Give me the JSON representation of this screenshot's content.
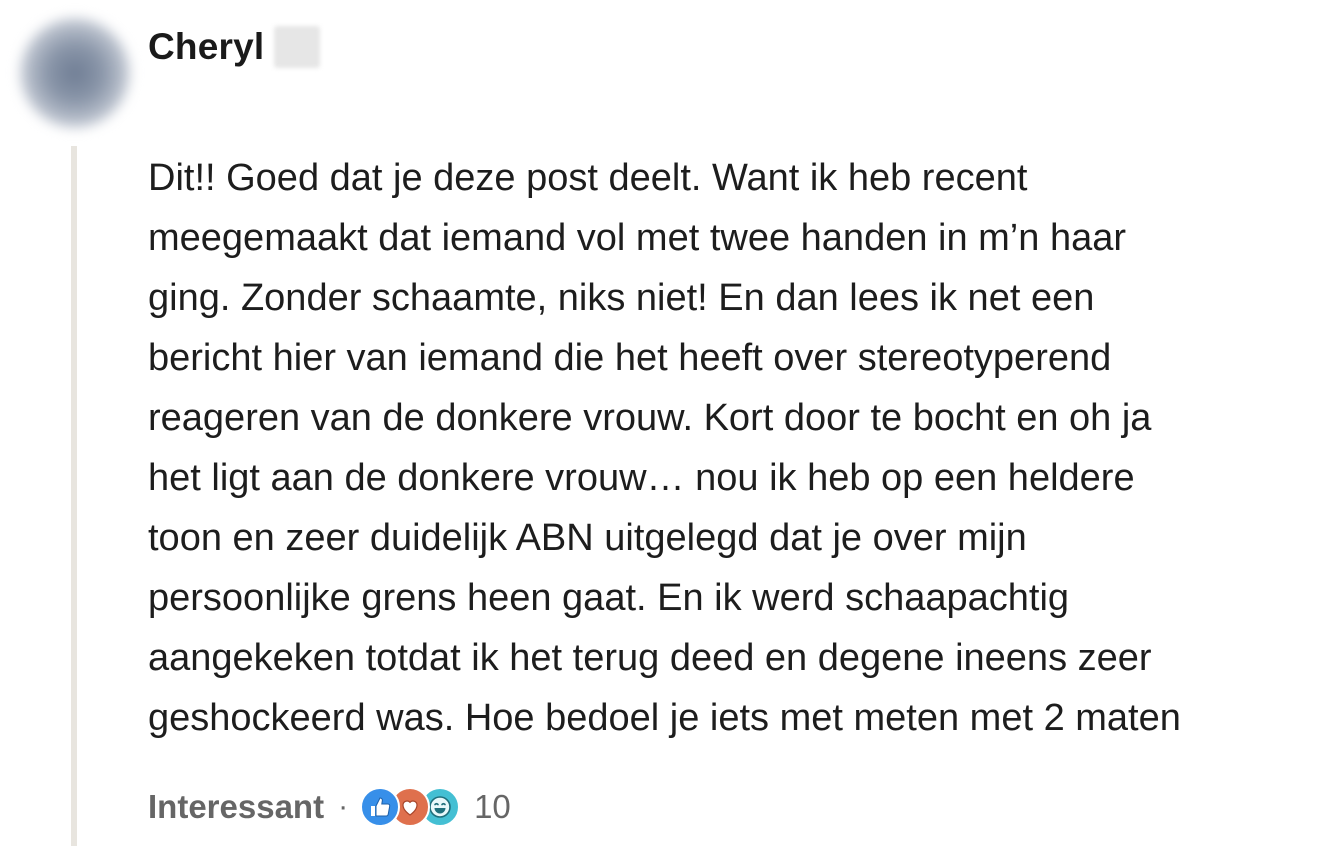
{
  "comment": {
    "author": {
      "name": "Cheryl"
    },
    "text_lines": [
      "Dit!! Goed dat je deze post deelt. Want ik heb recent",
      "meegemaakt dat iemand vol met twee handen in m’n haar",
      "ging. Zonder schaamte, niks niet! En dan lees ik net een",
      "bericht hier van iemand die het heeft over stereotyperend",
      "reageren van de donkere vrouw. Kort door te bocht en oh ja",
      "het ligt aan de donkere vrouw… nou ik heb op een heldere",
      "toon en zeer duidelijk ABN uitgelegd dat je over mijn",
      "persoonlijke grens heen gaat. En ik werd schaapachtig",
      "aangekeken totdat ik het terug deed en degene ineens zeer",
      "geshockeerd was. Hoe bedoel je iets met meten met 2 maten"
    ],
    "actions": {
      "reaction_label": "Interessant",
      "separator": "·",
      "reaction_count": "10",
      "reactions": [
        {
          "icon": "like-icon",
          "color": "#378fe9"
        },
        {
          "icon": "love-icon",
          "color": "#df704d"
        },
        {
          "icon": "funny-icon",
          "color": "#44bfd3"
        }
      ]
    }
  },
  "colors": {
    "text": "#1d1d1d",
    "muted": "#666666",
    "thread_line": "#e8e5df"
  }
}
